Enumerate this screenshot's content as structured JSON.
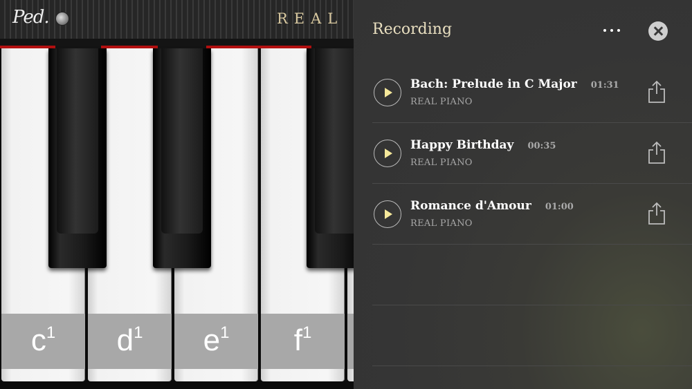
{
  "app": {
    "title": "REAL P",
    "pedal_label": "Ped."
  },
  "keyboard": {
    "white_keys": [
      {
        "note": "c",
        "octave": "1"
      },
      {
        "note": "d",
        "octave": "1"
      },
      {
        "note": "e",
        "octave": "1"
      },
      {
        "note": "f",
        "octave": "1"
      }
    ]
  },
  "panel": {
    "title": "Recording",
    "more_icon": "more-horizontal-icon",
    "close_icon": "close-icon"
  },
  "recordings": [
    {
      "name": "Bach: Prelude in C Major",
      "duration": "01:31",
      "source": "REAL PIANO"
    },
    {
      "name": "Happy Birthday",
      "duration": "00:35",
      "source": "REAL PIANO"
    },
    {
      "name": "Romance d'Amour",
      "duration": "01:00",
      "source": "REAL PIANO"
    }
  ],
  "colors": {
    "accent_gold": "#e9dfc0",
    "play_triangle": "#f5e89a",
    "felt_red": "#b21010"
  }
}
